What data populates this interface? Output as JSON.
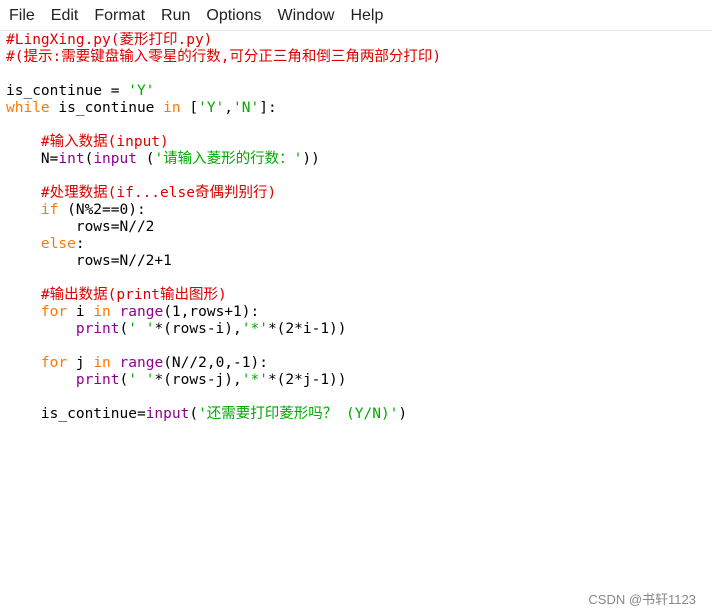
{
  "menu": [
    "File",
    "Edit",
    "Format",
    "Run",
    "Options",
    "Window",
    "Help"
  ],
  "code_lines": [
    [
      {
        "t": "#LingXing.py(菱形打印.py)",
        "c": "c"
      }
    ],
    [
      {
        "t": "#(提示:需要键盘输入零星的行数,可分正三角和倒三角两部分打印)",
        "c": "c"
      }
    ],
    [],
    [
      {
        "t": "is_continue = ",
        "c": ""
      },
      {
        "t": "'Y'",
        "c": "s"
      }
    ],
    [
      {
        "t": "while",
        "c": "k"
      },
      {
        "t": " is_continue ",
        "c": ""
      },
      {
        "t": "in",
        "c": "k"
      },
      {
        "t": " [",
        "c": ""
      },
      {
        "t": "'Y'",
        "c": "s"
      },
      {
        "t": ",",
        "c": ""
      },
      {
        "t": "'N'",
        "c": "s"
      },
      {
        "t": "]:",
        "c": ""
      }
    ],
    [],
    [
      {
        "t": "    ",
        "c": ""
      },
      {
        "t": "#输入数据(input)",
        "c": "c"
      }
    ],
    [
      {
        "t": "    N=",
        "c": ""
      },
      {
        "t": "int",
        "c": "b"
      },
      {
        "t": "(",
        "c": ""
      },
      {
        "t": "input",
        "c": "b"
      },
      {
        "t": " (",
        "c": ""
      },
      {
        "t": "'请输入菱形的行数：'",
        "c": "s"
      },
      {
        "t": "))",
        "c": ""
      }
    ],
    [],
    [
      {
        "t": "    ",
        "c": ""
      },
      {
        "t": "#处理数据(if...else奇偶判别行)",
        "c": "c"
      }
    ],
    [
      {
        "t": "    ",
        "c": ""
      },
      {
        "t": "if",
        "c": "k"
      },
      {
        "t": " (N%2==0):",
        "c": ""
      }
    ],
    [
      {
        "t": "        rows=N//2",
        "c": ""
      }
    ],
    [
      {
        "t": "    ",
        "c": ""
      },
      {
        "t": "else",
        "c": "k"
      },
      {
        "t": ":",
        "c": ""
      }
    ],
    [
      {
        "t": "        rows=N//2+1",
        "c": ""
      }
    ],
    [],
    [
      {
        "t": "    ",
        "c": ""
      },
      {
        "t": "#输出数据(print输出图形)",
        "c": "c"
      }
    ],
    [
      {
        "t": "    ",
        "c": ""
      },
      {
        "t": "for",
        "c": "k"
      },
      {
        "t": " i ",
        "c": ""
      },
      {
        "t": "in",
        "c": "k"
      },
      {
        "t": " ",
        "c": ""
      },
      {
        "t": "range",
        "c": "b"
      },
      {
        "t": "(1,rows+1):",
        "c": ""
      }
    ],
    [
      {
        "t": "        ",
        "c": ""
      },
      {
        "t": "print",
        "c": "b"
      },
      {
        "t": "(",
        "c": ""
      },
      {
        "t": "' '",
        "c": "s"
      },
      {
        "t": "*(rows-i),",
        "c": ""
      },
      {
        "t": "'*'",
        "c": "s"
      },
      {
        "t": "*(2*i-1))",
        "c": ""
      }
    ],
    [],
    [
      {
        "t": "    ",
        "c": ""
      },
      {
        "t": "for",
        "c": "k"
      },
      {
        "t": " j ",
        "c": ""
      },
      {
        "t": "in",
        "c": "k"
      },
      {
        "t": " ",
        "c": ""
      },
      {
        "t": "range",
        "c": "b"
      },
      {
        "t": "(N//2,0,-1):",
        "c": ""
      }
    ],
    [
      {
        "t": "        ",
        "c": ""
      },
      {
        "t": "print",
        "c": "b"
      },
      {
        "t": "(",
        "c": ""
      },
      {
        "t": "' '",
        "c": "s"
      },
      {
        "t": "*(rows-j),",
        "c": ""
      },
      {
        "t": "'*'",
        "c": "s"
      },
      {
        "t": "*(2*j-1))",
        "c": ""
      }
    ],
    [],
    [
      {
        "t": "    is_continue=",
        "c": ""
      },
      {
        "t": "input",
        "c": "b"
      },
      {
        "t": "(",
        "c": ""
      },
      {
        "t": "'还需要打印菱形吗？ (Y/N)'",
        "c": "s"
      },
      {
        "t": ")",
        "c": ""
      }
    ]
  ],
  "watermark": "CSDN @书轩1123"
}
